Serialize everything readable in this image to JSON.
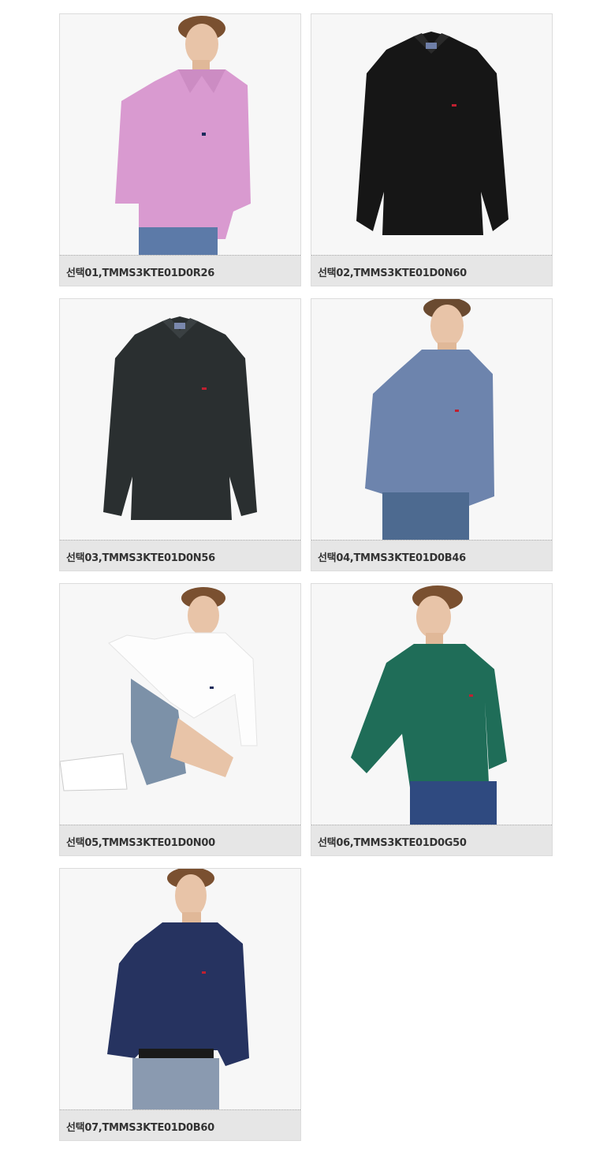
{
  "products": [
    {
      "label": "선택01,TMMS3KTE01D0R26",
      "shirt_color": "#d99ad0",
      "image": "model-photo"
    },
    {
      "label": "선택02,TMMS3KTE01D0N60",
      "shirt_color": "#161616",
      "image": "flat-shirt-photo"
    },
    {
      "label": "선택03,TMMS3KTE01D0N56",
      "shirt_color": "#2a2f30",
      "image": "flat-shirt-photo"
    },
    {
      "label": "선택04,TMMS3KTE01D0B46",
      "shirt_color": "#6d84ad",
      "image": "model-photo"
    },
    {
      "label": "선택05,TMMS3KTE01D0N00",
      "shirt_color": "#f7f7f7",
      "image": "seated-model-photo"
    },
    {
      "label": "선택06,TMMS3KTE01D0G50",
      "shirt_color": "#1f6d58",
      "image": "model-photo"
    },
    {
      "label": "선택07,TMMS3KTE01D0B60",
      "shirt_color": "#263360",
      "image": "model-photo"
    }
  ]
}
